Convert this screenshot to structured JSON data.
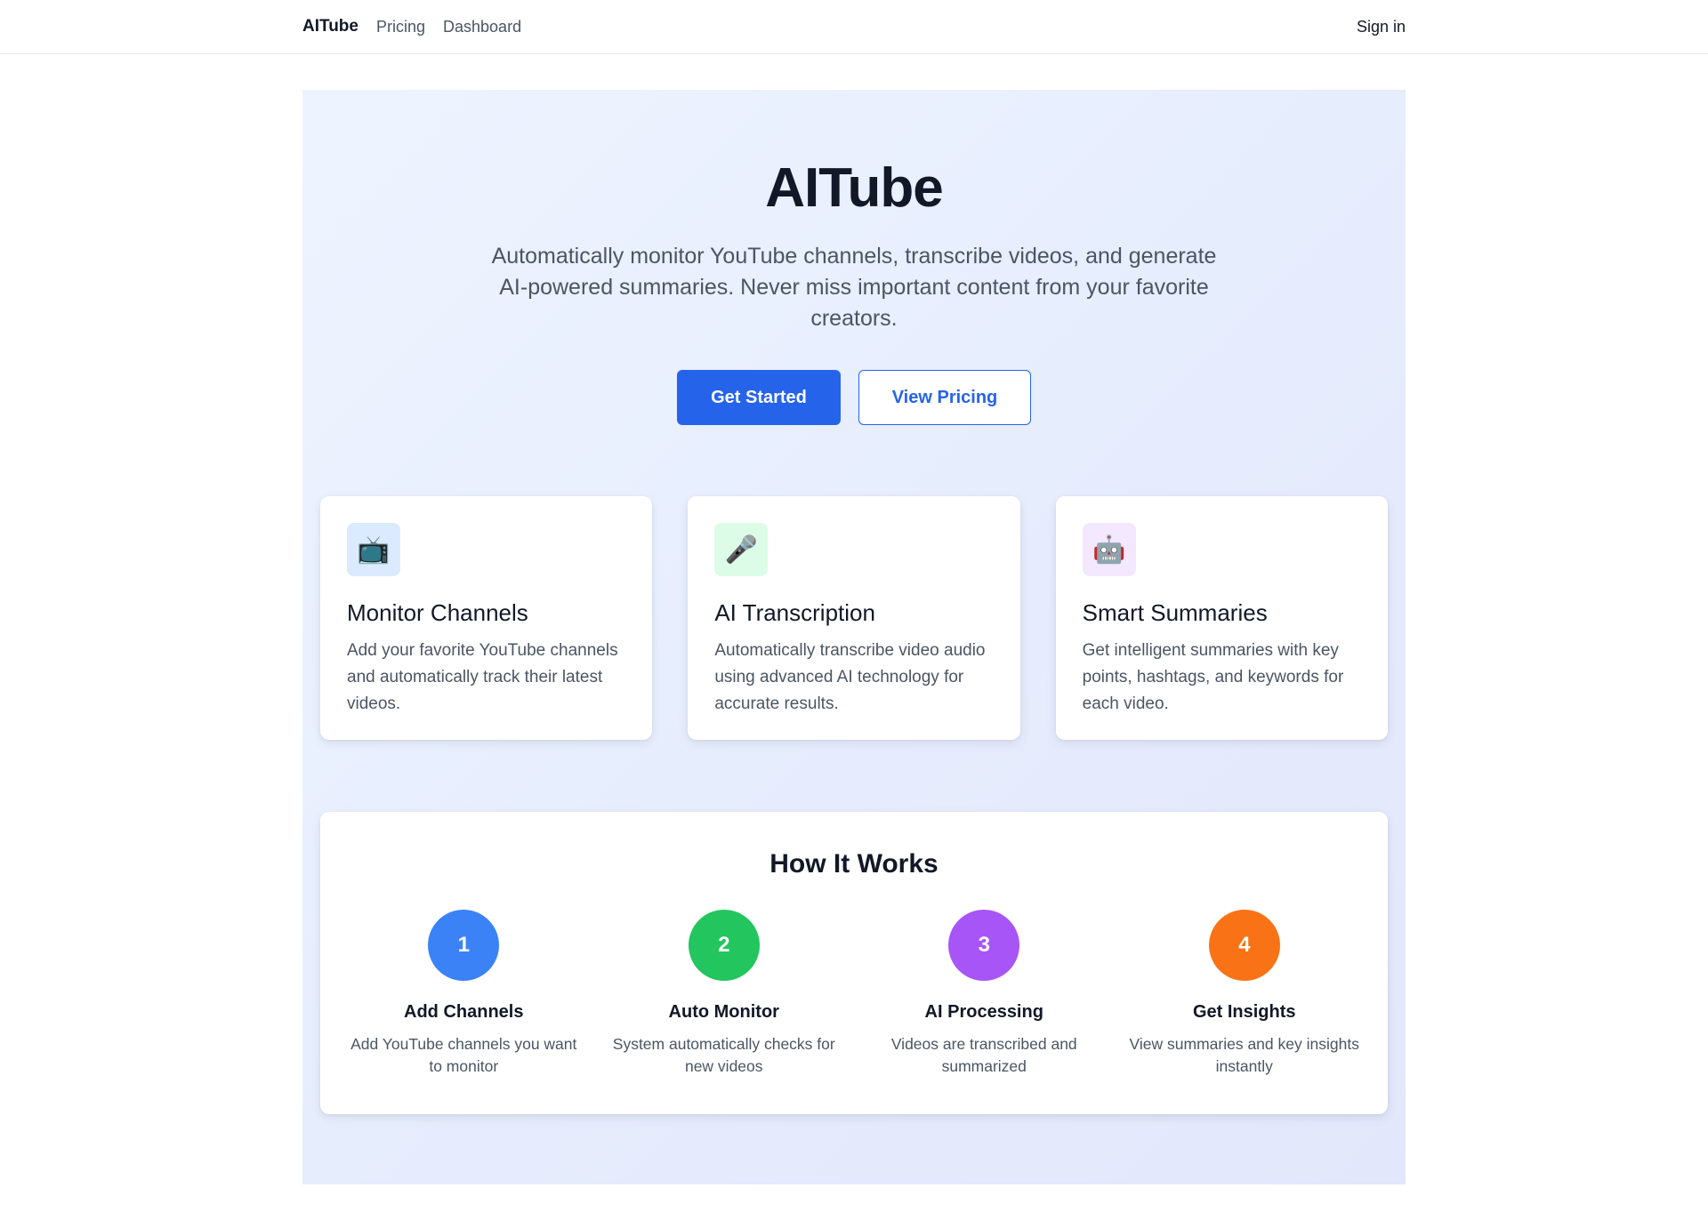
{
  "nav": {
    "brand": "AITube",
    "links": [
      "Pricing",
      "Dashboard"
    ],
    "signin": "Sign in"
  },
  "hero": {
    "title": "AITube",
    "subtitle": "Automatically monitor YouTube channels, transcribe videos, and generate AI-powered summaries. Never miss important content from your favorite creators.",
    "primary_cta": "Get Started",
    "secondary_cta": "View Pricing"
  },
  "features": [
    {
      "icon": "television-icon",
      "glyph": "📺",
      "icon_bg": "#dbeafe",
      "title": "Monitor Channels",
      "desc": "Add your favorite YouTube channels and automatically track their latest videos."
    },
    {
      "icon": "microphone-icon",
      "glyph": "🎤",
      "icon_bg": "#dcfce7",
      "title": "AI Transcription",
      "desc": "Automatically transcribe video audio using advanced AI technology for accurate results."
    },
    {
      "icon": "robot-icon",
      "glyph": "🤖",
      "icon_bg": "#f3e8ff",
      "title": "Smart Summaries",
      "desc": "Get intelligent summaries with key points, hashtags, and keywords for each video."
    }
  ],
  "how": {
    "title": "How It Works",
    "steps": [
      {
        "num": "1",
        "color": "#3b82f6",
        "title": "Add Channels",
        "desc": "Add YouTube channels you want to monitor"
      },
      {
        "num": "2",
        "color": "#22c55e",
        "title": "Auto Monitor",
        "desc": "System automatically checks for new videos"
      },
      {
        "num": "3",
        "color": "#a855f7",
        "title": "AI Processing",
        "desc": "Videos are transcribed and summarized"
      },
      {
        "num": "4",
        "color": "#f97316",
        "title": "Get Insights",
        "desc": "View summaries and key insights instantly"
      }
    ]
  },
  "colors": {
    "primary": "#2563eb"
  }
}
